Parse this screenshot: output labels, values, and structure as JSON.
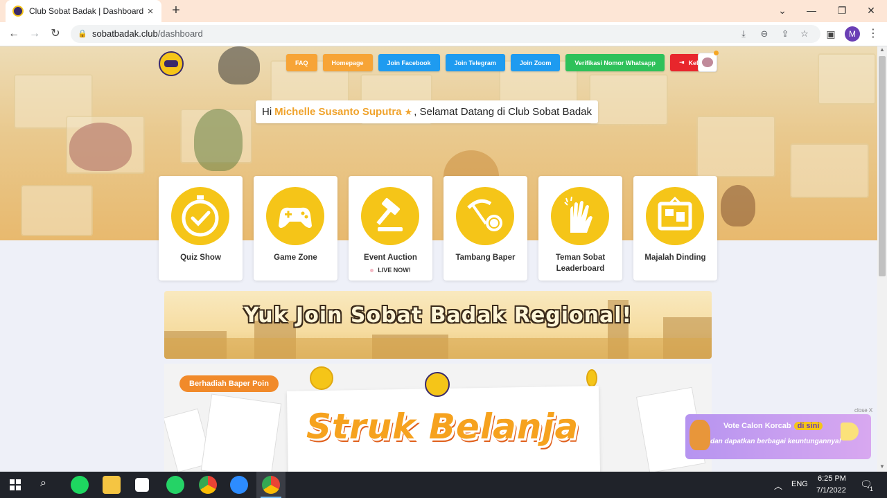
{
  "browser": {
    "tab_title": "Club Sobat Badak | Dashboard",
    "new_tab": "+",
    "tab_close": "×",
    "url_host": "sobatbadak.club",
    "url_path": "/dashboard",
    "window_controls": {
      "minimize": "—",
      "maximize": "❐",
      "close": "✕",
      "collapse": "⌄"
    },
    "profile_initial": "M"
  },
  "header": {
    "nav": [
      {
        "label": "FAQ",
        "color": "#f7a436"
      },
      {
        "label": "Homepage",
        "color": "#f7a436"
      },
      {
        "label": "Join Facebook",
        "color": "#1e9bf0"
      },
      {
        "label": "Join Telegram",
        "color": "#1e9bf0"
      },
      {
        "label": "Join Zoom",
        "color": "#1e9bf0"
      },
      {
        "label": "Verifikasi Nomor Whatsapp",
        "color": "#2ec15a"
      },
      {
        "label": "Keluar",
        "color": "#e8262c"
      }
    ]
  },
  "greeting": {
    "prefix": "Hi",
    "name": "Michelle Susanto Suputra",
    "star": "★",
    "suffix": ", Selamat Datang di Club Sobat Badak"
  },
  "menu": [
    {
      "label": "Quiz Show",
      "icon": "stopwatch-check-icon"
    },
    {
      "label": "Game Zone",
      "icon": "gamepad-icon"
    },
    {
      "label": "Event Auction",
      "icon": "gavel-icon",
      "badge": "LIVE NOW!"
    },
    {
      "label": "Tambang Baper",
      "icon": "pickaxe-coin-icon"
    },
    {
      "label": "Teman Sobat Leaderboard",
      "icon": "high-five-icon"
    },
    {
      "label": "Majalah Dinding",
      "icon": "bulletin-board-icon"
    }
  ],
  "banners": {
    "regional": "Yuk Join Sobat Badak Regional!",
    "struk_ribbon": "Berhadiah Baper Poin",
    "struk_title": "Struk Belanja"
  },
  "promo": {
    "close": "close X",
    "line1": "Vote Calon Korcab",
    "line1_highlight": "di sini",
    "line2": "dan dapatkan berbagai keuntungannya!"
  },
  "taskbar": {
    "lang": "ENG",
    "time": "6:25 PM",
    "date": "7/1/2022",
    "notif_count": "1"
  }
}
